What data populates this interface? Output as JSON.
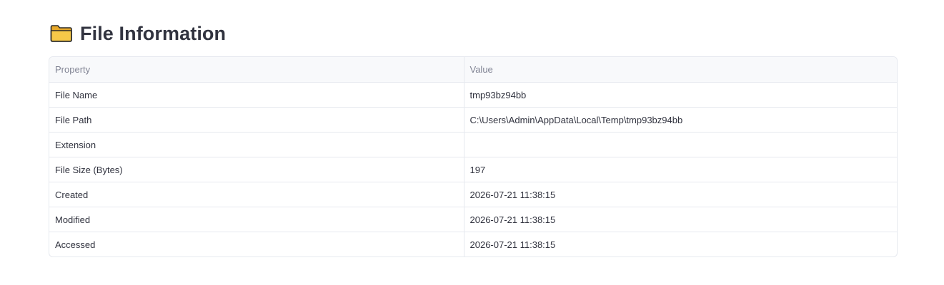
{
  "heading": {
    "icon": "folder-icon",
    "title": "File Information"
  },
  "table": {
    "columns": [
      "Property",
      "Value"
    ],
    "rows": [
      {
        "property": "File Name",
        "value": "tmp93bz94bb"
      },
      {
        "property": "File Path",
        "value": "C:\\Users\\Admin\\AppData\\Local\\Temp\\tmp93bz94bb"
      },
      {
        "property": "Extension",
        "value": ""
      },
      {
        "property": "File Size (Bytes)",
        "value": "197"
      },
      {
        "property": "Created",
        "value": "2026-07-21 11:38:15"
      },
      {
        "property": "Modified",
        "value": "2026-07-21 11:38:15"
      },
      {
        "property": "Accessed",
        "value": "2026-07-21 11:38:15"
      }
    ]
  },
  "colors": {
    "folder_fill": "#f7c948",
    "folder_outline": "#2b2b2b",
    "border": "#e6e9ef",
    "header_bg": "#f8f9fb",
    "header_text": "#818494",
    "text": "#31333f"
  }
}
